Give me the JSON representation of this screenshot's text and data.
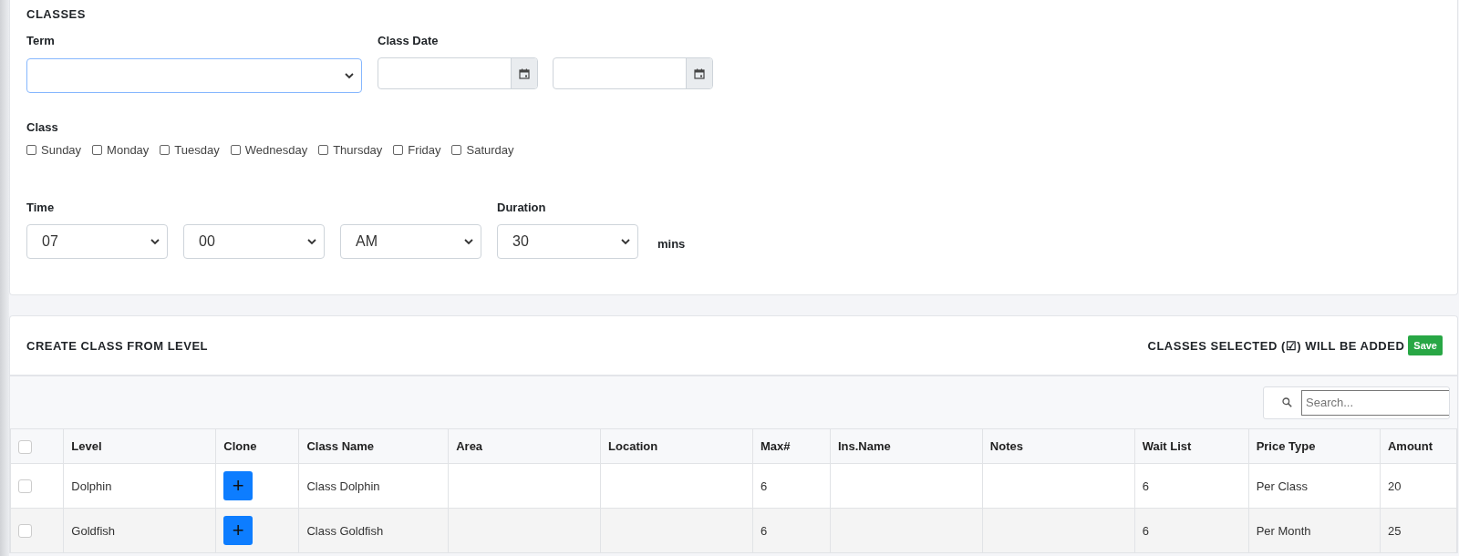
{
  "classes_panel": {
    "title": "CLASSES",
    "term": {
      "label": "Term",
      "focused": true
    },
    "class_date": {
      "label": "Class Date"
    },
    "class_days": {
      "label": "Class",
      "days": [
        {
          "label": "Sunday",
          "checked": false
        },
        {
          "label": "Monday",
          "checked": false
        },
        {
          "label": "Tuesday",
          "checked": false
        },
        {
          "label": "Wednesday",
          "checked": false
        },
        {
          "label": "Thursday",
          "checked": false
        },
        {
          "label": "Friday",
          "checked": false
        },
        {
          "label": "Saturday",
          "checked": false
        }
      ]
    },
    "time": {
      "label": "Time",
      "hour": "07",
      "minute": "00",
      "meridiem": "AM"
    },
    "duration": {
      "label": "Duration",
      "value": "30",
      "unit": "mins"
    }
  },
  "level_panel": {
    "title": "CREATE CLASS FROM LEVEL",
    "note": "CLASSES SELECTED (☑) WILL BE ADDED",
    "save_button": "Save",
    "search": {
      "placeholder": "Search..."
    },
    "table": {
      "select_all_checked": false,
      "columns": [
        "Level",
        "Clone",
        "Class Name",
        "Area",
        "Location",
        "Max#",
        "Ins.Name",
        "Notes",
        "Wait List",
        "Price Type",
        "Amount"
      ],
      "rows": [
        {
          "selected": false,
          "level": "Dolphin",
          "clone": "+",
          "class_name": "Class Dolphin",
          "max": "6",
          "wait_list": "6",
          "price_type": "Per Class",
          "amount": "20"
        },
        {
          "selected": false,
          "level": "Goldfish",
          "clone": "+",
          "class_name": "Class Goldfish",
          "max": "6",
          "wait_list": "6",
          "price_type": "Per Month",
          "amount": "25"
        }
      ]
    }
  }
}
